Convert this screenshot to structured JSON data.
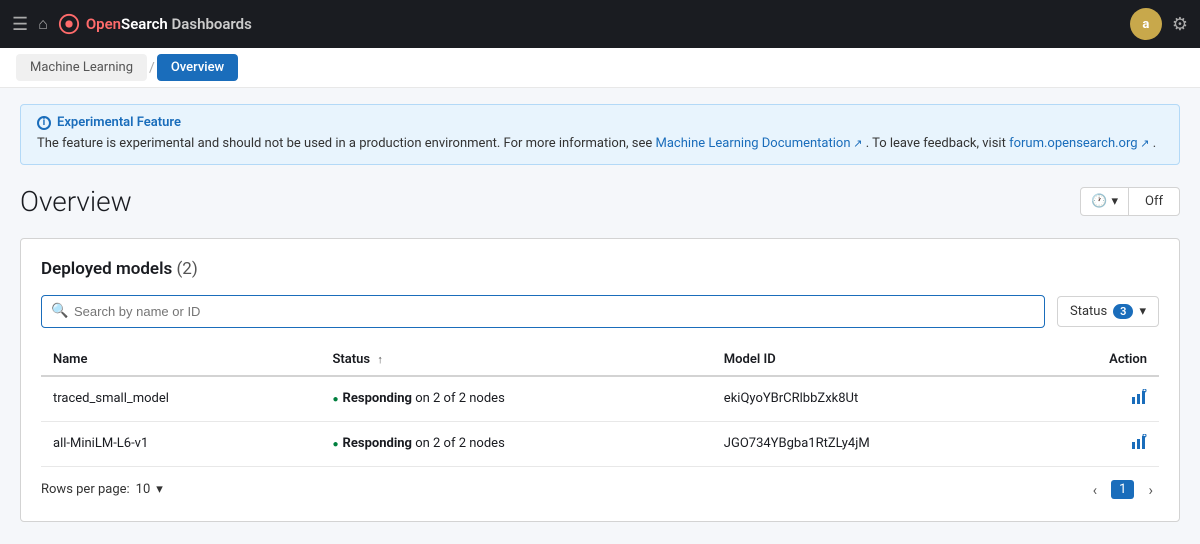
{
  "brand": {
    "logo_open": "Open",
    "logo_search": "Search",
    "logo_dashboards": "Dashboards"
  },
  "topbar": {
    "avatar_label": "a",
    "avatar_color": "#c8a84b"
  },
  "breadcrumb": {
    "parent_label": "Machine Learning",
    "current_label": "Overview"
  },
  "experimental_banner": {
    "title": "Experimental Feature",
    "text_before": "The feature is experimental and should not be used in a production environment. For more information, see",
    "link1_label": "Machine Learning Documentation",
    "text_middle": ". To leave feedback, visit",
    "link2_label": "forum.opensearch.org",
    "text_after": "."
  },
  "page": {
    "title": "Overview"
  },
  "refresh_control": {
    "icon_label": "clock",
    "chevron_label": "▾",
    "status": "Off"
  },
  "deployed_models": {
    "title": "Deployed models",
    "count_label": "(2)",
    "search_placeholder": "Search by name or ID",
    "status_filter_label": "Status",
    "status_filter_count": "3",
    "columns": {
      "name": "Name",
      "status": "Status",
      "model_id": "Model ID",
      "action": "Action"
    },
    "rows": [
      {
        "name": "traced_small_model",
        "status_bold": "Responding",
        "status_rest": " on 2 of 2 nodes",
        "model_id": "ekiQyoYBrCRlbbZxk8Ut"
      },
      {
        "name": "all-MiniLM-L6-v1",
        "status_bold": "Responding",
        "status_rest": " on 2 of 2 nodes",
        "model_id": "JGO734YBgba1RtZLy4jM"
      }
    ],
    "pagination": {
      "rows_per_page_label": "Rows per page:",
      "rows_per_page_value": "10",
      "current_page": "1"
    }
  }
}
